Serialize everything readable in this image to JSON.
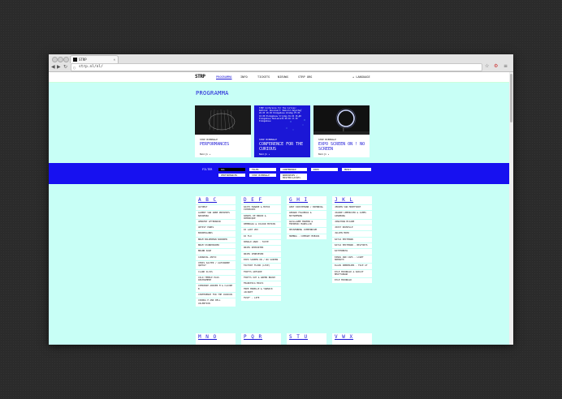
{
  "browser": {
    "tab_title": "STRP",
    "tab_close": "×",
    "back": "◀",
    "forward": "▶",
    "reload": "↻",
    "url": "strp.nl/nl/",
    "right_icons": [
      "☆",
      "⚙",
      "≡"
    ]
  },
  "site": {
    "logo": "STRP",
    "nav": [
      "PROGRAMMA",
      "INFO",
      "TICKETS",
      "NIEUWS",
      "STRP ORG"
    ],
    "language": "▴ LANGUAGE",
    "heading": "PROGRAMMA"
  },
  "cards": [
    {
      "label": "STRP BIENNALE",
      "title": "PERFORMANCES",
      "more": "Bekijk ▸",
      "desc": ""
    },
    {
      "label": "STRP BIENNALE",
      "title": "CONFERENCE FOR THE CURIOUS",
      "more": "Bekijk ▸",
      "desc": "STRP Conference for the Curious: Rethink: Reconnect: Rebuild Zaterdag 26.03 10.30 Klokgebouw Zondag 27.03 10.00 Klokgebouw Vrijdag 01.04 16.00 Klokgebouw Muziekcafé 08.04 17.30 Klokgebouw"
    },
    {
      "label": "STRP BIENNALE",
      "title": "EXPO SCREEN ON ! NO SCREEN",
      "more": "Bekijk ▸",
      "desc": ""
    }
  ],
  "filter": {
    "label": "FILTER",
    "buttons": [
      "ALL",
      "FILMS",
      "CONFERENCE",
      "EXPO",
      "MUSIC",
      "PERFORMANCES",
      "STRP BIENNALE",
      "WORKSHOPS / MASTERCLASSES"
    ],
    "active": "ALL"
  },
  "columns": [
    {
      "head": "A B C",
      "items": [
        "AUTOMAT",
        "ALBERT VAN ABBE PRESENTS NAKAMURA",
        "AMBIENT AFTERNOON",
        "ARTIST PANEL",
        "BORDERLANDS",
        "BRAM BOLDERMAN NOORDEN",
        "BRAM STANDHOUDER",
        "BRANN DAGE",
        "CARNAVAL ANTIC",
        "CHRIS SALTER / ALEXANDRE QUESSY",
        "CLARK ILYAS",
        "COLD TEMPLE PLUS INSTRUMENT",
        "COMPANIE ADRIEN M & CLAIRE B",
        "CONFERENCE FOR THE CURIOUS",
        "CORDUG P AND DELL VALENTION"
      ]
    },
    {
      "head": "D E F",
      "items": [
        "DAITO MANABE & MOTOI ISHIBASHI",
        "DANIEL DE BRUIN & DOMINIQUE",
        "DEMERGIA & COLOUR MOTION",
        "DJ LADY ZOO",
        "DJ FLO",
        "DONALD ABAD - TASTE",
        "DRIES DEPOORTER",
        "DRIES VERHOEVEN",
        "EXPO SCREEN ON / NO SCREEN",
        "FACTORY FLOOR (LIVE)",
        "FORTYS ARTSIDE",
        "FORTYS OUT & GREEN BRUSH",
        "FRANCESCA MASTA",
        "FREE MORELLE & YANNICK JACQUET",
        "FUSE* - LIFE"
      ]
    },
    {
      "head": "G H I",
      "items": [
        "GERT KIRSTEMANN / BIENNIAL",
        "GERARD FIGUERAS & MATHAMMANS",
        "GUILLAUME MARMIN & FREDERIC MARELLIN",
        "HEISENBERG COMPENDIUM",
        "HUMBUG - COMPANY MOBIUS"
      ]
    },
    {
      "head": "J K L",
      "items": [
        "JEROEN VAN MONTFOORT",
        "JOANIE LEMERCIER & JAMES GINZBURG",
        "JONATHAN MCCABE",
        "JOOST NOUVELLE",
        "JULIEN MIER",
        "KATJA HEITMANN",
        "KATJA HEITMANN - BELFORTS",
        "KATTERBOSS",
        "KINGS AND CAPS - LIGHT MAMOUTH",
        "KLAUS OBERMAIER - FACE AT",
        "KYLE MCDONALD & KADLIT BHATTANGAR",
        "KYLE MCDONALD"
      ]
    }
  ],
  "bottom_heads": [
    "M N O",
    "P Q R",
    "S T U",
    "V W X"
  ]
}
